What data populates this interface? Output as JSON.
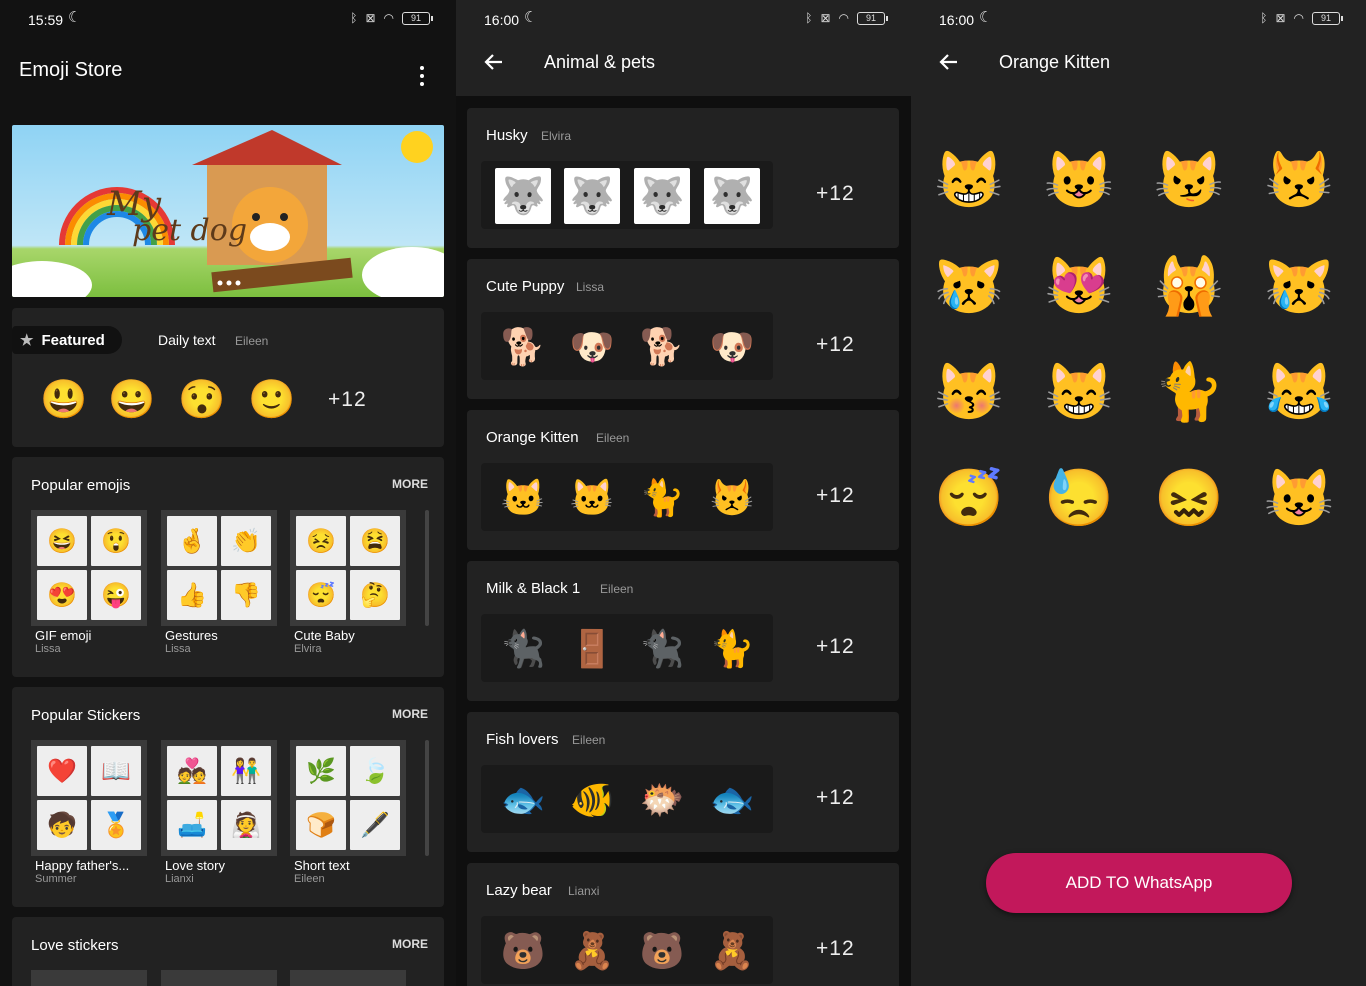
{
  "screen1": {
    "status_time": "15:59",
    "battery": "91",
    "title": "Emoji Store",
    "featured_tab": "Featured",
    "daily_tab": "Daily text",
    "daily_author": "Eileen",
    "featured_more": "+12",
    "featured_stickers": [
      "😃",
      "😀",
      "😯",
      "🙂"
    ],
    "sections": [
      {
        "title": "Popular emojis",
        "more": "MORE",
        "packs": [
          {
            "name": "GIF emoji",
            "author": "Lissa",
            "icons": [
              "😆",
              "😲",
              "😍",
              "😜"
            ]
          },
          {
            "name": "Gestures",
            "author": "Lissa",
            "icons": [
              "🤞",
              "👏",
              "👍",
              "👎"
            ]
          },
          {
            "name": "Cute Baby",
            "author": "Elvira",
            "icons": [
              "😣",
              "😫",
              "😴",
              "🤔"
            ]
          }
        ]
      },
      {
        "title": "Popular Stickers",
        "more": "MORE",
        "packs": [
          {
            "name": "Happy father's...",
            "author": "Summer",
            "icons": [
              "❤️",
              "📖",
              "🧒",
              "🏅"
            ]
          },
          {
            "name": "Love story",
            "author": "Lianxi",
            "icons": [
              "💑",
              "👫",
              "🛋️",
              "👰"
            ]
          },
          {
            "name": "Short text",
            "author": "Eileen",
            "icons": [
              "🌿",
              "🍃",
              "🍞",
              "🖋️"
            ]
          }
        ]
      },
      {
        "title": "Love stickers",
        "more": "MORE"
      }
    ]
  },
  "screen2": {
    "status_time": "16:00",
    "battery": "91",
    "title": "Animal & pets",
    "rows": [
      {
        "title": "Husky",
        "author": "Elvira",
        "more": "+12",
        "icons": [
          "🐺",
          "🐺",
          "🐺",
          "🐺"
        ]
      },
      {
        "title": "Cute Puppy",
        "author": "Lissa",
        "more": "+12",
        "icons": [
          "🐕",
          "🐶",
          "🐕",
          "🐶"
        ]
      },
      {
        "title": "Orange Kitten",
        "author": "Eileen",
        "more": "+12",
        "icons": [
          "🐱",
          "🐱",
          "🐈",
          "😾"
        ]
      },
      {
        "title": "Milk & Black 1",
        "author": "Eileen",
        "more": "+12",
        "icons": [
          "🐈‍⬛",
          "🚪",
          "🐈‍⬛",
          "🐈"
        ]
      },
      {
        "title": "Fish lovers",
        "author": "Eileen",
        "more": "+12",
        "icons": [
          "🐟",
          "🐠",
          "🐡",
          "🐟"
        ]
      },
      {
        "title": "Lazy bear",
        "author": "Lianxi",
        "more": "+12",
        "icons": [
          "🐻",
          "🧸",
          "🐻",
          "🧸"
        ]
      }
    ]
  },
  "screen3": {
    "status_time": "16:00",
    "battery": "91",
    "title": "Orange Kitten",
    "stickers": [
      "😸",
      "😺",
      "😼",
      "😾",
      "😿",
      "😻",
      "🙀",
      "😿",
      "😽",
      "😸",
      "🐈",
      "😹",
      "😴",
      "😓",
      "😖",
      "😺"
    ],
    "add_button": "ADD TO WhatsApp"
  },
  "colors": {
    "accent": "#c2185b",
    "card": "#222222",
    "background": "#121212"
  },
  "icons": {
    "back": "arrow-left-icon",
    "menu": "more-vertical-icon",
    "star": "star-icon"
  }
}
